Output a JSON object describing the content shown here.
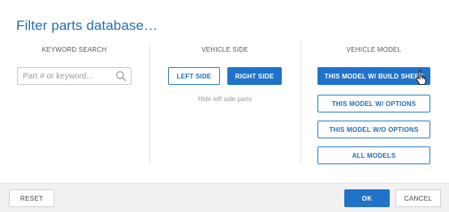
{
  "dialog": {
    "title": "Filter parts database…"
  },
  "keyword_search": {
    "heading": "KEYWORD SEARCH",
    "placeholder": "Part # or keyword...",
    "value": ""
  },
  "vehicle_side": {
    "heading": "VEHICLE SIDE",
    "left_label": "LEFT SIDE",
    "right_label": "RIGHT SIDE",
    "hint": "Hide left side parts",
    "selected": "RIGHT SIDE"
  },
  "vehicle_model": {
    "heading": "VEHICLE MODEL",
    "options": [
      "THIS MODEL W/ BUILD SHEET",
      "THIS MODEL w/ OPTIONS",
      "THIS MODEL w/o OPTIONS",
      "ALL MODELS"
    ],
    "selected": "THIS MODEL W/ BUILD SHEET"
  },
  "footer": {
    "reset_label": "RESET",
    "ok_label": "OK",
    "cancel_label": "CANCEL"
  },
  "icons": {
    "search": "search-icon",
    "cursor": "hand-pointer-cursor"
  },
  "colors": {
    "accent": "#1f73c9",
    "title": "#1f6fb6"
  }
}
